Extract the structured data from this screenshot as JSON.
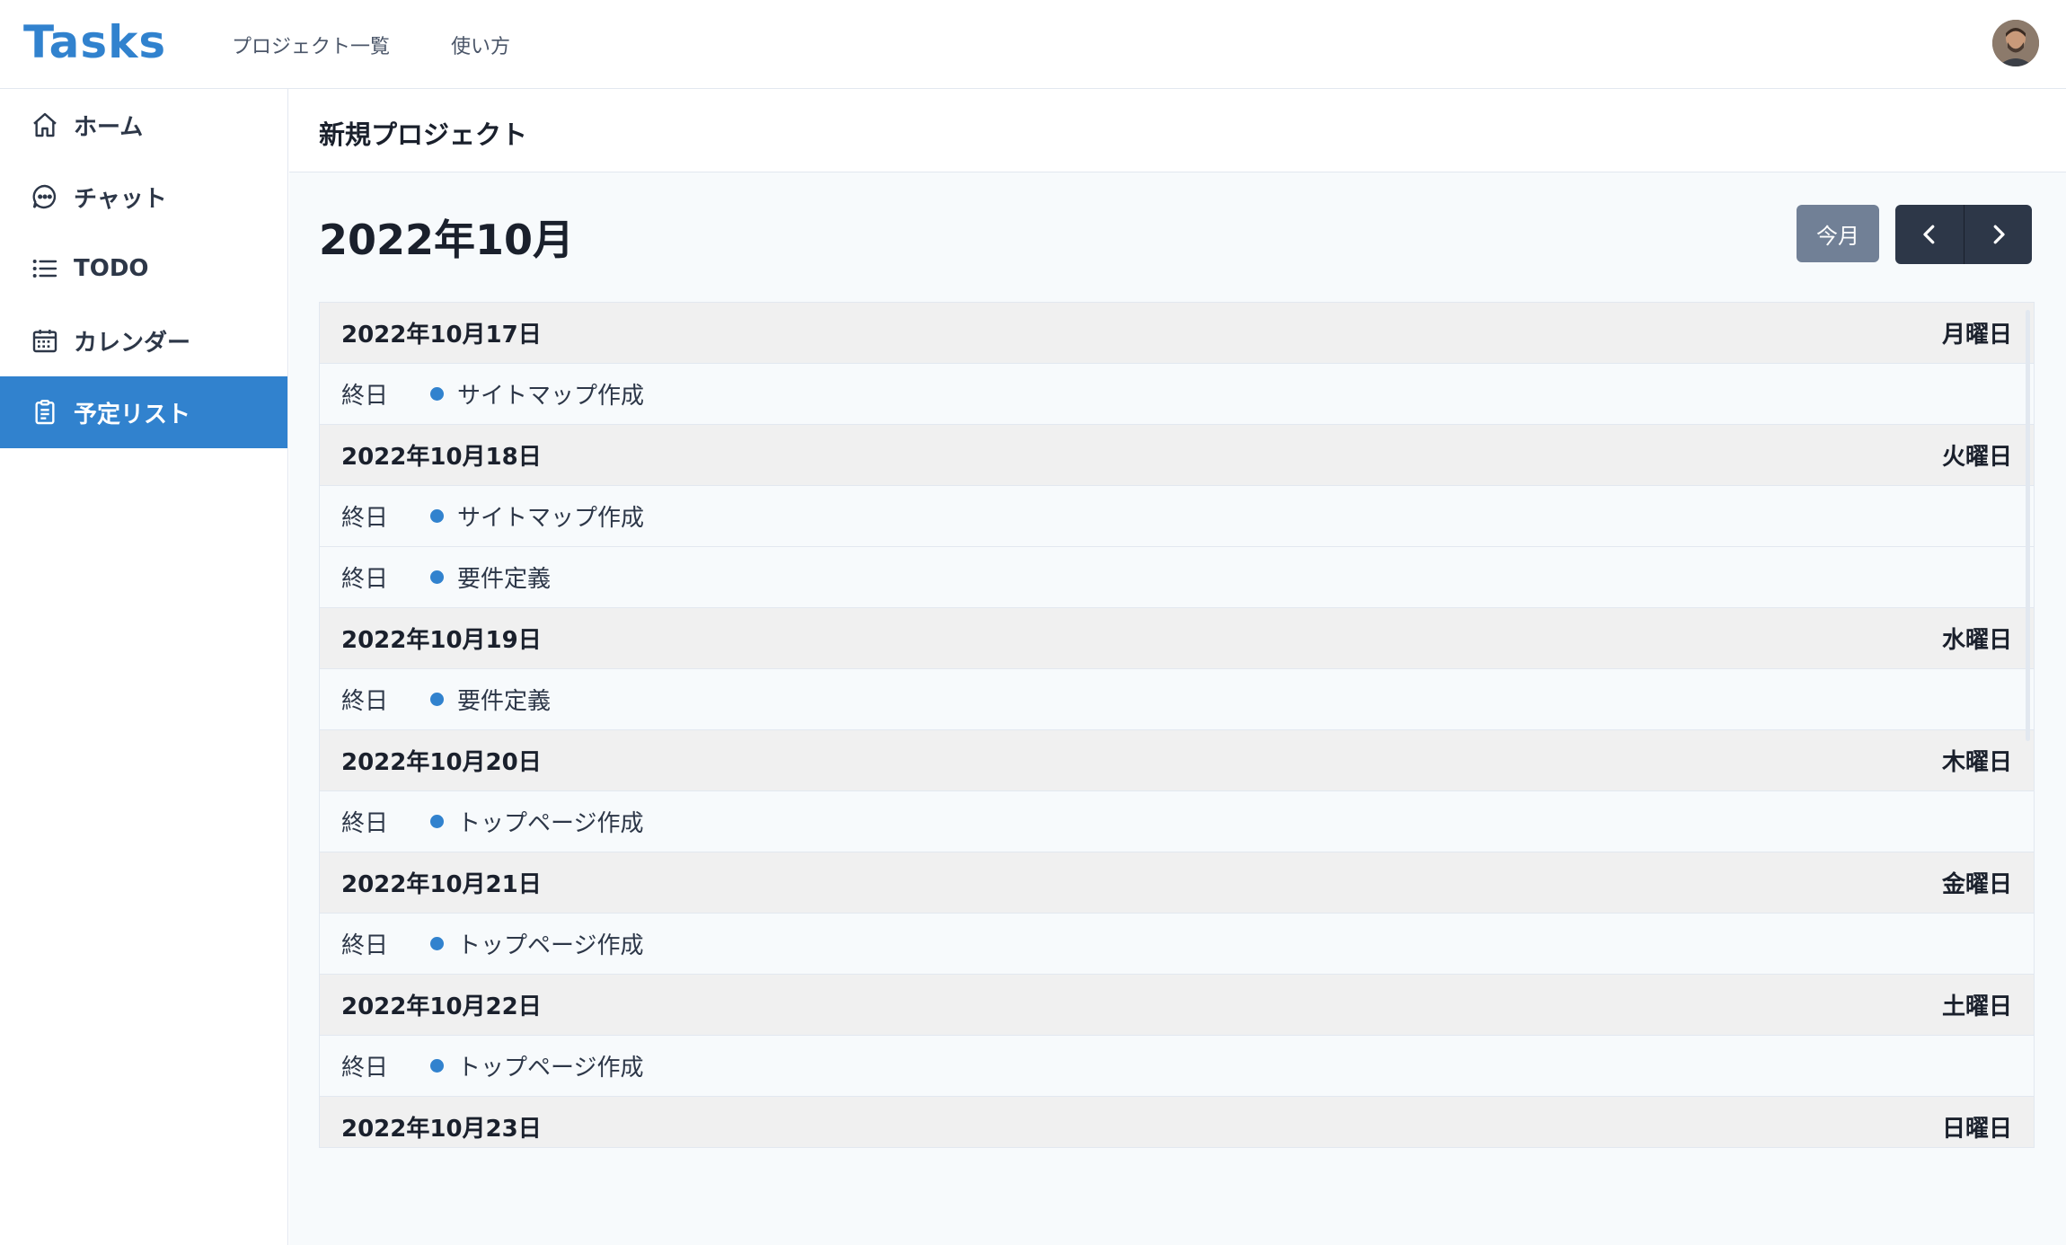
{
  "app": {
    "logo": "Tasks"
  },
  "topnav": {
    "projects": "プロジェクト一覧",
    "howto": "使い方"
  },
  "sidebar": {
    "items": [
      {
        "label": "ホーム",
        "icon": "home-icon"
      },
      {
        "label": "チャット",
        "icon": "chat-icon"
      },
      {
        "label": "TODO",
        "icon": "list-icon"
      },
      {
        "label": "カレンダー",
        "icon": "calendar-icon"
      },
      {
        "label": "予定リスト",
        "icon": "clipboard-icon",
        "active": true
      }
    ]
  },
  "project": {
    "title": "新規プロジェクト"
  },
  "calendar": {
    "month": "2022年10月",
    "today_label": "今月",
    "days": [
      {
        "date": "2022年10月17日",
        "dow": "月曜日",
        "events": [
          {
            "time": "終日",
            "title": "サイトマップ作成"
          }
        ]
      },
      {
        "date": "2022年10月18日",
        "dow": "火曜日",
        "events": [
          {
            "time": "終日",
            "title": "サイトマップ作成"
          },
          {
            "time": "終日",
            "title": "要件定義"
          }
        ]
      },
      {
        "date": "2022年10月19日",
        "dow": "水曜日",
        "events": [
          {
            "time": "終日",
            "title": "要件定義"
          }
        ]
      },
      {
        "date": "2022年10月20日",
        "dow": "木曜日",
        "events": [
          {
            "time": "終日",
            "title": "トップページ作成"
          }
        ]
      },
      {
        "date": "2022年10月21日",
        "dow": "金曜日",
        "events": [
          {
            "time": "終日",
            "title": "トップページ作成"
          }
        ]
      },
      {
        "date": "2022年10月22日",
        "dow": "土曜日",
        "events": [
          {
            "time": "終日",
            "title": "トップページ作成"
          }
        ]
      },
      {
        "date": "2022年10月23日",
        "dow": "日曜日",
        "events": []
      }
    ]
  },
  "colors": {
    "accent": "#3182ce",
    "dark": "#2d3748",
    "muted": "#718096"
  }
}
